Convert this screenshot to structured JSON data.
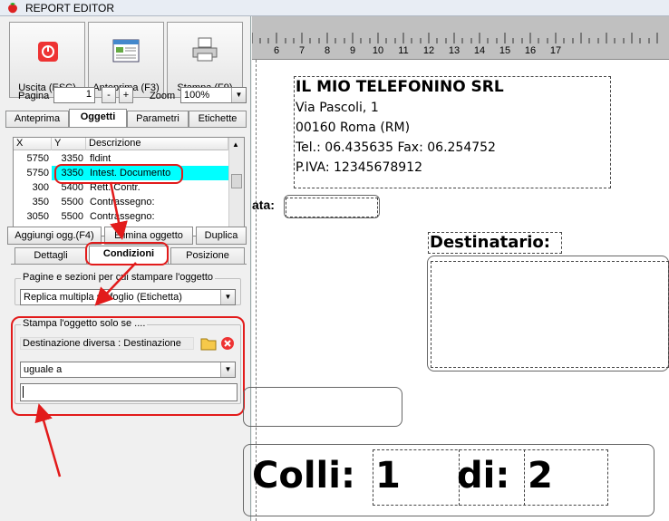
{
  "window": {
    "title": "REPORT EDITOR"
  },
  "toolbar": {
    "exit_label": "Uscita (ESC)",
    "preview_label": "Anteprima (F3)",
    "print_label": "Stampa (F9)"
  },
  "pager": {
    "page_label": "Pagina",
    "page_value": "1",
    "minus": "-",
    "plus": "+",
    "zoom_label": "Zoom",
    "zoom_value": "100%"
  },
  "main_tabs": [
    "Anteprima",
    "Oggetti",
    "Parametri",
    "Etichette"
  ],
  "objects_table": {
    "columns": [
      "X",
      "Y",
      "Descrizione"
    ],
    "rows": [
      {
        "x": "5750",
        "y": "3350",
        "desc": "fldint"
      },
      {
        "x": "5750",
        "y": "3350",
        "desc": "Intest. Documento"
      },
      {
        "x": "300",
        "y": "5400",
        "desc": "Rett. Contr."
      },
      {
        "x": "350",
        "y": "5500",
        "desc": "Contrassegno:"
      },
      {
        "x": "3050",
        "y": "5500",
        "desc": "Contrassegno:"
      }
    ]
  },
  "object_actions": {
    "add": "Aggiungi ogg.(F4)",
    "delete": "Elimina oggetto",
    "duplicate": "Duplica"
  },
  "sub_tabs": [
    "Dettagli",
    "Condizioni",
    "Posizione"
  ],
  "pages_group": {
    "title": "Pagine e sezioni per cui stampare l'oggetto",
    "value": "Replica multipla su foglio (Etichetta)"
  },
  "condition_group": {
    "title": "Stampa l'oggetto solo se ....",
    "field": "Destinazione diversa : Destinazione",
    "operator": "uguale a",
    "value": ""
  },
  "report": {
    "ruler": [
      "6",
      "7",
      "8",
      "9",
      "10",
      "11",
      "12",
      "13",
      "14",
      "15",
      "16",
      "17"
    ],
    "company": "IL MIO TELEFONINO SRL",
    "address": "Via Pascoli, 1",
    "city": "00160 Roma (RM)",
    "phones": "Tel.: 06.435635 Fax: 06.254752",
    "vat": "P.IVA: 12345678912",
    "data_label": "ata:",
    "recipient_label": "Destinatario:",
    "colli_label": "Colli:",
    "colli_value": "1",
    "di_label": "di:",
    "di_value": "2"
  },
  "colors": {
    "selection": "#00ffff",
    "annotation": "#e21b1b"
  }
}
